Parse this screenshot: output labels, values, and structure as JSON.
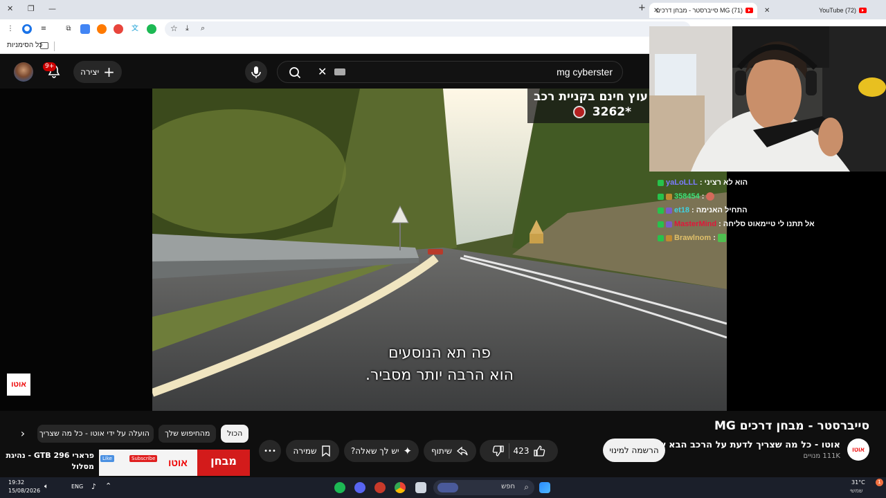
{
  "browser": {
    "tabs": [
      {
        "title": "(72) YouTube",
        "active": false
      },
      {
        "title": "(71) MG סייברסטר - מבחן דרכים",
        "active": true
      }
    ],
    "new_tab": "+",
    "bookmarks_label": "כל הסימניות"
  },
  "youtube": {
    "search_value": "mg cyberster",
    "create_label": "יצירה",
    "notif_count": "9+"
  },
  "video": {
    "banner_line1": "עוץ חינם בקניית רכב",
    "banner_line2": "3262*",
    "subtitle_line1": "פה תא הנוסעים",
    "subtitle_line2": "הוא הרבה יותר מסביר.",
    "watermark": "אוטו"
  },
  "chat": [
    {
      "user": "yaLoLLL",
      "message": "הוא לא רציני",
      "user_color": "#7b7bff"
    },
    {
      "user": "358454",
      "message": "",
      "user_color": "#3fe07a"
    },
    {
      "user": "et18",
      "message": "התחיל האנימה",
      "user_color": "#3fd1e0"
    },
    {
      "user": "MasterMind",
      "message": "אל תתנו לי טיימאוט סליחה",
      "user_color": "#e0163a"
    },
    {
      "user": "Brawlnom",
      "message": "",
      "user_color": "#e0c06a"
    }
  ],
  "info": {
    "title": "סייברסטר - מבחן דרכים MG",
    "channel_name": "אוטו - כל מה שצריך לדעת על הרכב הבא שלך",
    "subscribers": "111K מנויים",
    "subscribe_label": "הרשמה למינוי",
    "like_count": "423",
    "share_label": "שיתוף",
    "ask_label": "יש לך שאלה?",
    "save_label": "שמירה",
    "more_label": "•••"
  },
  "chips": [
    "הכול",
    "מהחיפוש שלך",
    "הועלה על ידי אוטו - כל מה שצריך"
  ],
  "related": {
    "title_line1": "פרארי GTB 296 - נהיגת",
    "title_line2": "מסלול",
    "thumb_brand": "מבחן",
    "thumb_logo": "אוטו",
    "thumb_like": "Like",
    "thumb_subscribe": "Subscribe"
  },
  "taskbar": {
    "time": "19:32",
    "date": "15/08/2026",
    "lang": "ENG",
    "search_placeholder": "חפש",
    "weather_temp": "31°C",
    "weather_label": "שמשי",
    "notif": "1"
  }
}
